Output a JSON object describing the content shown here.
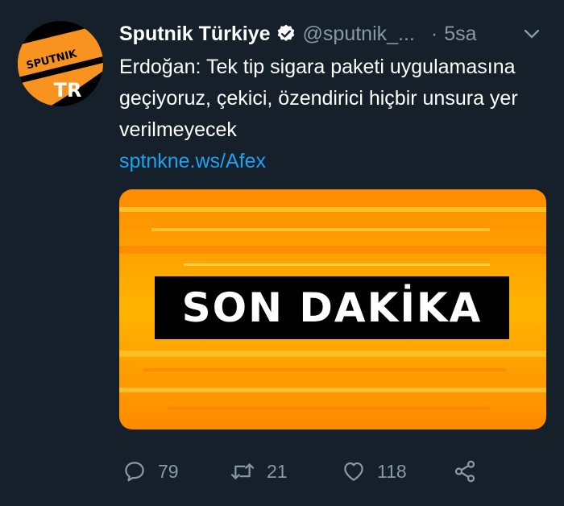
{
  "account": {
    "display_name": "Sputnik Türkiye",
    "handle": "@sputnik_...",
    "separator": "·",
    "time": "5sa",
    "avatar_logo_text": "SPUTNIK",
    "avatar_badge_text": "TR"
  },
  "tweet": {
    "text": "Erdoğan: Tek tip sigara paketi uygulamasına geçiyoruz, çekici, özendirici hiçbir unsura yer verilmeyecek",
    "link": "sptnkne.ws/Afex"
  },
  "media": {
    "banner_text": "SON DAKİKA"
  },
  "actions": {
    "reply_count": "79",
    "retweet_count": "21",
    "like_count": "118"
  },
  "colors": {
    "background": "#15202b",
    "text_primary": "#ffffff",
    "text_secondary": "#8899a6",
    "link": "#1da1f2",
    "banner_orange": "#ff9a00",
    "avatar_orange": "#f7931e"
  },
  "icons": [
    "verified-icon",
    "chevron-down-icon",
    "reply-icon",
    "retweet-icon",
    "like-icon",
    "share-icon"
  ]
}
